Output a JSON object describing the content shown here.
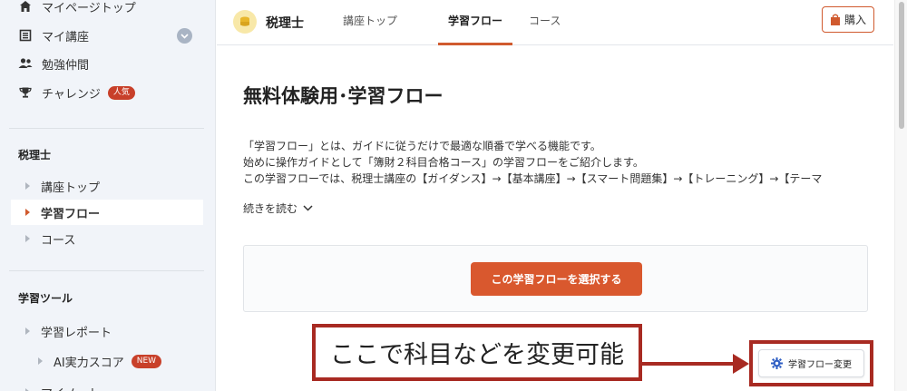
{
  "sidebar": {
    "main_items": [
      {
        "label": "マイページトップ",
        "icon": "home-icon"
      },
      {
        "label": "マイ講座",
        "icon": "list-icon"
      },
      {
        "label": "勉強仲間",
        "icon": "users-icon"
      },
      {
        "label": "チャレンジ",
        "icon": "trophy-icon",
        "badge": "人気"
      }
    ],
    "course_section": {
      "title": "税理士",
      "items": [
        {
          "label": "講座トップ",
          "active": false
        },
        {
          "label": "学習フロー",
          "active": true
        },
        {
          "label": "コース",
          "active": false
        }
      ]
    },
    "tools_section": {
      "title": "学習ツール",
      "items": [
        {
          "label": "学習レポート"
        },
        {
          "label": "AI実力スコア",
          "badge": "NEW"
        },
        {
          "label": "マイノート"
        }
      ]
    }
  },
  "header": {
    "brand": "税理士",
    "tabs": [
      {
        "label": "講座トップ",
        "active": false
      },
      {
        "label": "学習フロー",
        "active": true
      },
      {
        "label": "コース",
        "active": false
      }
    ],
    "buy_label": "購入"
  },
  "main": {
    "title": "無料体験用･学習フロー",
    "description_lines": [
      "「学習フロー」とは、ガイドに従うだけで最適な順番で学べる機能です。",
      "始めに操作ガイドとして「簿財２科目合格コース」の学習フローをご紹介します。",
      "この学習フローでは、税理士講座の【ガイダンス】→【基本講座】→【スマート問題集】→【トレーニング】→【テーマ"
    ],
    "read_more": "続きを読む",
    "select_button": "この学習フローを選択する",
    "change_flow_button": "学習フロー変更"
  },
  "annotation": {
    "callout_text": "ここで科目などを変更可能"
  },
  "colors": {
    "accent": "#d9582e",
    "annotation": "#a82a22",
    "sidebar_bg": "#f1f4f9"
  }
}
